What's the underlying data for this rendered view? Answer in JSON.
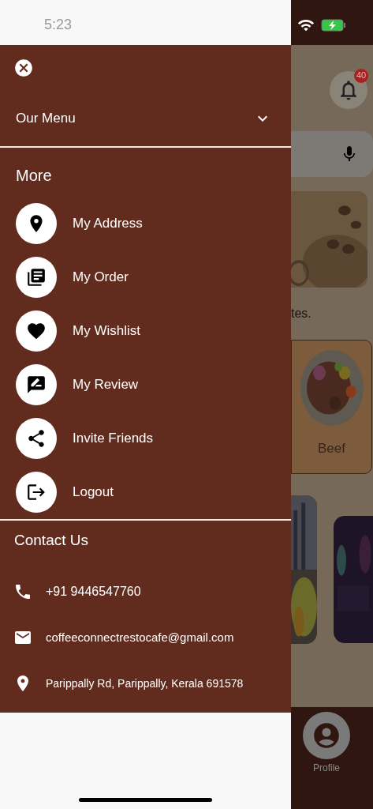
{
  "status_bar": {
    "time": "5:23"
  },
  "drawer": {
    "menu_section": {
      "label": "Our Menu",
      "expanded": false
    },
    "more_title": "More",
    "items": [
      {
        "label": "My Address"
      },
      {
        "label": "My Order"
      },
      {
        "label": "My Wishlist"
      },
      {
        "label": "My Review"
      },
      {
        "label": "Invite Friends"
      },
      {
        "label": "Logout"
      }
    ],
    "contact": {
      "title": "Contact Us",
      "phone": "+91 9446547760",
      "email": "coffeeconnectrestocafe@gmail.com",
      "address": "Parippally Rd, Parippally, Kerala 691578"
    }
  },
  "background_screen": {
    "notification_badge": "40",
    "partial_text": "tes.",
    "category": {
      "label": "Beef"
    },
    "nav_item": {
      "label": "Profile"
    }
  }
}
